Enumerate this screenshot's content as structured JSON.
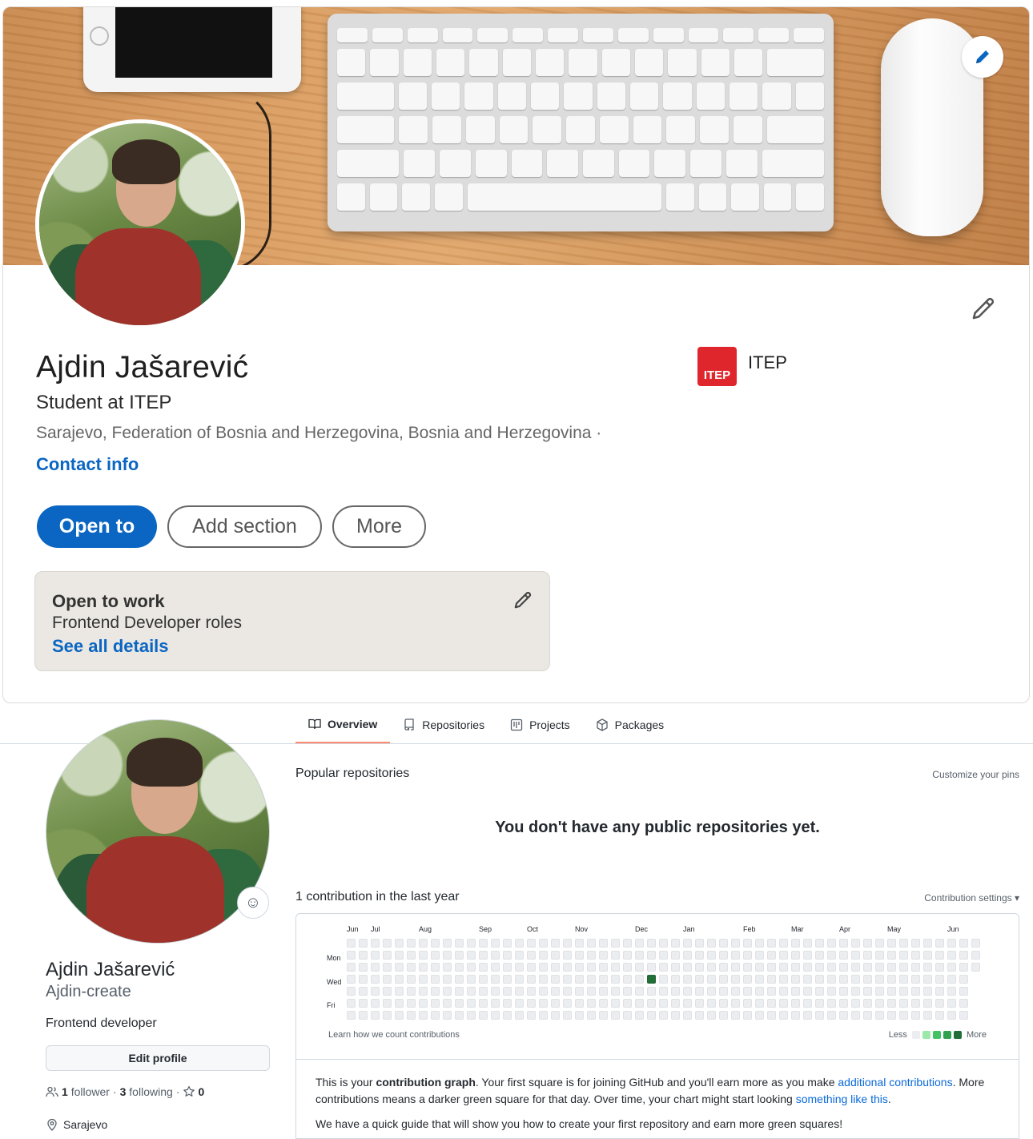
{
  "linkedin": {
    "name": "Ajdin Jašarević",
    "headline": "Student at ITEP",
    "location": "Sarajevo, Federation of Bosnia and Herzegovina, Bosnia and Herzegovina ·",
    "contact_info": "Contact info",
    "company": {
      "logo_text": "ITEP",
      "name": "ITEP",
      "logo_color": "#e0262d"
    },
    "buttons": {
      "open_to": "Open to",
      "add_section": "Add section",
      "more": "More"
    },
    "open_to_work": {
      "title": "Open to work",
      "roles": "Frontend Developer roles",
      "details_link": "See all details"
    },
    "accent_color": "#0a66c2"
  },
  "github": {
    "tabs": [
      {
        "label": "Overview",
        "icon": "book-icon",
        "active": true
      },
      {
        "label": "Repositories",
        "icon": "repo-icon",
        "active": false
      },
      {
        "label": "Projects",
        "icon": "project-icon",
        "active": false
      },
      {
        "label": "Packages",
        "icon": "package-icon",
        "active": false
      }
    ],
    "profile": {
      "name": "Ajdin Jašarević",
      "login": "Ajdin-create",
      "bio": "Frontend developer",
      "edit_profile": "Edit profile",
      "followers_count": "1",
      "followers_label": "follower",
      "following_count": "3",
      "following_label": "following",
      "stars_count": "0",
      "location": "Sarajevo"
    },
    "popular_title": "Popular repositories",
    "customize_pins": "Customize your pins",
    "no_repos": "You don't have any public repositories yet.",
    "contrib_count": "1 contribution in the last year",
    "contrib_settings": "Contribution settings ▾",
    "graph": {
      "months": [
        "Jun",
        "Jul",
        "Aug",
        "Sep",
        "Oct",
        "Nov",
        "Dec",
        "Jan",
        "Feb",
        "Mar",
        "Apr",
        "May",
        "Jun"
      ],
      "day_labels": [
        "Mon",
        "Wed",
        "Fri"
      ],
      "weeks": 53,
      "active_cell": {
        "week": 25,
        "day": 3,
        "level": 4
      },
      "learn_link": "Learn how we count contributions",
      "legend_less": "Less",
      "legend_more": "More",
      "legend_colors": [
        "#ebedf0",
        "#9be9a8",
        "#40c463",
        "#30a14e",
        "#216e39"
      ]
    },
    "info": {
      "p1_a": "This is your ",
      "p1_bold": "contribution graph",
      "p1_b": ". Your first square is for joining GitHub and you'll earn more as you make ",
      "p1_link1": "additional contributions",
      "p1_c": ". More contributions means a darker green square for that day. Over time, your chart might start looking ",
      "p1_link2": "something like this",
      "p1_d": ".",
      "p2": "We have a quick guide that will show you how to create your first repository and earn more green squares!"
    }
  }
}
